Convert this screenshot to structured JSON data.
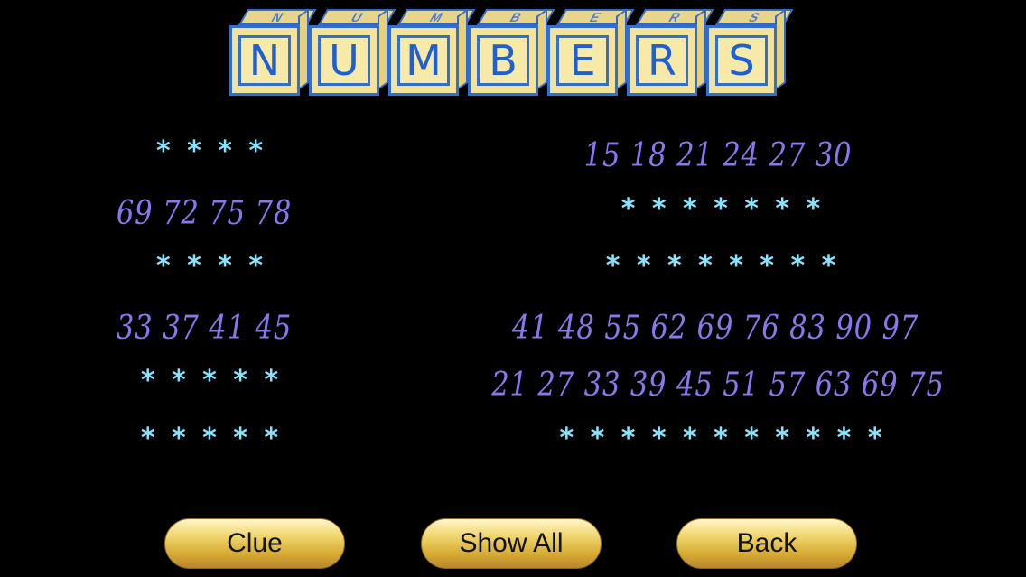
{
  "title": {
    "letters": [
      "N",
      "U",
      "M",
      "B",
      "E",
      "R",
      "S"
    ],
    "top_letters": [
      "N",
      "U",
      "M",
      "B",
      "E",
      "R",
      "S"
    ],
    "colors": {
      "face": "#f4e39a",
      "border": "#2e6fd1",
      "letter": "#1f5fd0"
    }
  },
  "left_column": [
    {
      "type": "stars",
      "text": "* * * *"
    },
    {
      "type": "numbers",
      "text": "69 72 75 78"
    },
    {
      "type": "stars",
      "text": "* * * *"
    },
    {
      "type": "numbers",
      "text": "33 37 41 45"
    },
    {
      "type": "stars",
      "text": "* * * * *"
    },
    {
      "type": "stars",
      "text": "* * * * *"
    }
  ],
  "right_column": [
    {
      "type": "numbers",
      "text": "15 18 21 24 27 30"
    },
    {
      "type": "stars",
      "text": "* * * * * * *"
    },
    {
      "type": "stars",
      "text": "* * * * * * * *"
    },
    {
      "type": "numbers",
      "text": "41 48 55 62 69 76 83 90 97"
    },
    {
      "type": "numbers",
      "text": "21 27 33 39 45 51 57 63 69 75"
    },
    {
      "type": "stars",
      "text": "* * * * * * * * * * *"
    }
  ],
  "buttons": {
    "clue": "Clue",
    "show_all": "Show All",
    "back": "Back"
  },
  "colors": {
    "numbers": "#8a76ee",
    "stars": "#86e4ff",
    "button": "#f0d66e",
    "background": "#000000"
  }
}
